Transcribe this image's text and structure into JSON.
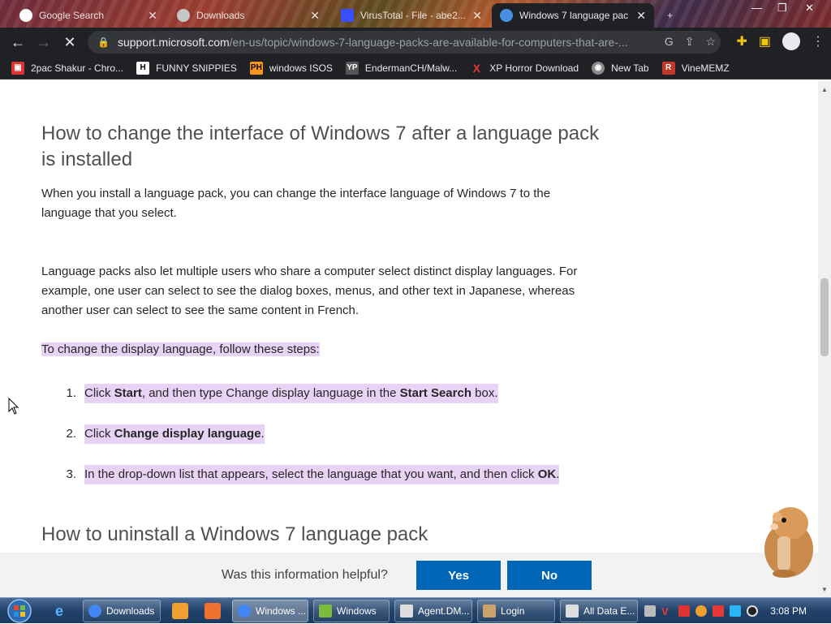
{
  "browser": {
    "tabs": [
      {
        "label": "Google Search",
        "active": false
      },
      {
        "label": "Downloads",
        "active": false
      },
      {
        "label": "VirusTotal - File - abe2...",
        "active": false
      },
      {
        "label": "Windows 7 language pac",
        "active": true
      }
    ],
    "new_tab_glyph": "+",
    "address": {
      "host": "support.microsoft.com",
      "path": "/en-us/topic/windows-7-language-packs-are-available-for-computers-that-are-..."
    },
    "bookmarks": [
      {
        "label": "2pac Shakur - Chro...",
        "icon": "music-icon",
        "badge": "▣",
        "color": "#d33"
      },
      {
        "label": "FUNNY SNIPPIES",
        "icon": "h-logo-icon",
        "badge": "H",
        "color": "#ffffff"
      },
      {
        "label": "windows ISOS",
        "icon": "ph-logo-icon",
        "badge": "PH",
        "color": "#f7971d"
      },
      {
        "label": "EndermanCH/Malw...",
        "icon": "yp-logo-icon",
        "badge": "YP",
        "color": "#555555"
      },
      {
        "label": "XP Horror Download",
        "icon": "x-logo-icon",
        "badge": "X",
        "color": "#202124"
      },
      {
        "label": "New Tab",
        "icon": "globe-icon",
        "badge": "◉",
        "color": "#8a8a8a"
      },
      {
        "label": "VineMEMZ",
        "icon": "r-logo-icon",
        "badge": "R",
        "color": "#c0392b"
      }
    ]
  },
  "article": {
    "heading1": "How to change the interface of Windows 7 after a language pack is installed",
    "para1": "When you install a language pack, you can change the interface language of Windows 7 to the language that you select.",
    "para2": "Language packs also let multiple users who share a computer select distinct display languages. For example, one user can select to see the dialog boxes, menus, and other text in Japanese, whereas another user can select to see the same content in French.",
    "steps_intro": "To change the display language, follow these steps:",
    "steps": [
      {
        "num": "1.",
        "a": "Click ",
        "b": "Start",
        "c": ", and then type Change display language in the ",
        "d": "Start Search",
        "e": " box."
      },
      {
        "num": "2.",
        "a": "Click ",
        "b": "Change display language",
        "c": "."
      },
      {
        "num": "3.",
        "a": "In the drop-down list that appears, select the language that you want, and then click ",
        "b": "OK",
        "c": "."
      }
    ],
    "heading2": "How to uninstall a Windows 7 language pack"
  },
  "feedback": {
    "question": "Was this information helpful?",
    "yes": "Yes",
    "no": "No"
  },
  "taskbar": {
    "buttons": [
      {
        "label": "Downloads",
        "icon": "chrome-icon"
      },
      {
        "label": "Windows ...",
        "icon": "chrome-icon"
      },
      {
        "label": "Windows",
        "icon": "windows-explorer-icon"
      },
      {
        "label": "Agent.DM...",
        "icon": "app-icon"
      },
      {
        "label": "Login",
        "icon": "user-icon"
      },
      {
        "label": "All Data E...",
        "icon": "app-icon"
      }
    ],
    "clock": "3:08 PM"
  },
  "colors": {
    "highlight": "#e8d2f5",
    "feedback_button": "#0067b8",
    "chrome_dark": "#202124"
  }
}
